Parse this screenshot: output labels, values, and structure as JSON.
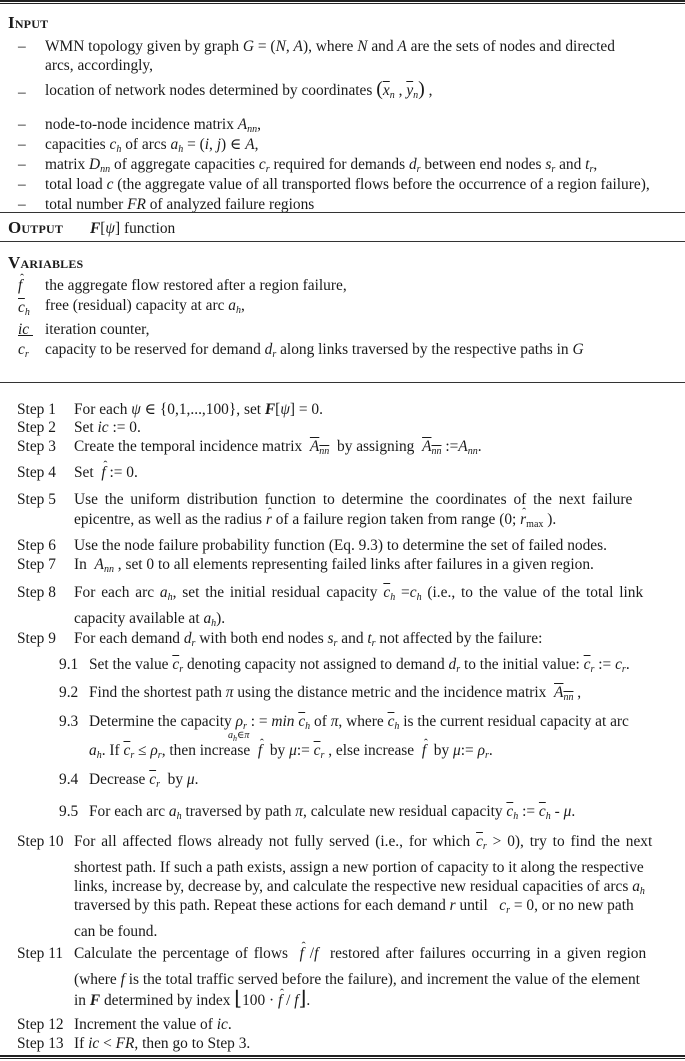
{
  "input": {
    "heading": "Input",
    "items": [
      {
        "parts": [
          "WMN topology given by graph ",
          "G",
          " = (",
          "N",
          ", ",
          "A",
          "), where ",
          "N",
          " and ",
          "A",
          " are the sets of nodes and directed"
        ],
        "line1": "WMN topology given by graph G = (N, A), where N and A are the sets of nodes and directed",
        "line2": "arcs, accordingly,"
      },
      {
        "line1": "location of network nodes determined by coordinates",
        "math": "(x̄n, ȳn),"
      },
      {
        "line1": "node-to-node incidence matrix",
        "sym": "Ann,"
      },
      {
        "line1": "capacities ch of arcs ah = (i, j) ∈ A,"
      },
      {
        "line1": "matrix Dnn of aggregate capacities cr required for demands dr between end nodes sr and tr,"
      },
      {
        "line1": "total load c (the aggregate value of all transported flows before the occurrence of a region failure),"
      },
      {
        "line1": "total number FR of analyzed failure regions"
      }
    ],
    "bullet": "–"
  },
  "output": {
    "heading": "Output",
    "text": "F[ψ] function"
  },
  "variables": {
    "heading": "Variables",
    "items": [
      {
        "symbol": "f̂",
        "text": "the aggregate flow restored after a region failure,"
      },
      {
        "symbol": "c̄h",
        "text": "free (residual) capacity at arc ah,"
      },
      {
        "symbol": "ic",
        "text": "iteration counter,"
      },
      {
        "symbol": "c̄r",
        "text": "capacity to be reserved for demand dr along links traversed by the respective paths in G"
      }
    ]
  },
  "steps": [
    {
      "label": "Step 1",
      "text": "For each ψ ∈ {0,1,...,100}, set F[ψ] = 0."
    },
    {
      "label": "Step 2",
      "text": "Set ic := 0."
    },
    {
      "label": "Step 3",
      "text": "Create the temporal incidence matrix Ānn by assigning Ānn :=Ann."
    },
    {
      "label": "Step 4",
      "text": "Set f̂ := 0."
    },
    {
      "label": "Step 5",
      "line1": "Use the uniform distribution function to determine the coordinates  of the next failure",
      "line2": "epicentre, as well as the radius r̂ of a failure region taken from range (0; r̂max)."
    },
    {
      "label": "Step 6",
      "text": "Use the node failure probability function (Eq. 9.3) to determine the set of failed nodes."
    },
    {
      "label": "Step 7",
      "text": "In Ānn , set 0 to all elements representing failed links after failures in a given region."
    },
    {
      "label": "Step 8",
      "line1": "For each arc ah, set the initial residual capacity c̄h =ch (i.e., to the value of the total link",
      "line2": "capacity available at ah)."
    },
    {
      "label": "Step 9",
      "text": "For each demand dr with both end nodes sr and tr not affected by the failure:",
      "substeps": [
        {
          "label": "9.1",
          "text": "Set the value c̄r denoting capacity not assigned to demand dr to the initial value: c̄r := cr."
        },
        {
          "label": "9.2",
          "text": "Find the shortest path π using the distance metric and the incidence matrix Ānn ,"
        },
        {
          "label": "9.3",
          "line1": "Determine the capacity ρr : = min(ah∈π) c̄h of π, where c̄h is the current residual capacity at arc",
          "line2": "ah. If c̄r ≤ ρr, then increase f̂ by μ:= c̄r , else increase f̂ by μ:= ρr."
        },
        {
          "label": "9.4",
          "text": "Decrease c̄r by μ."
        },
        {
          "label": "9.5",
          "text": "For each arc ah traversed by path π, calculate new residual capacity c̄h := c̄h - μ."
        }
      ]
    },
    {
      "label": "Step 10",
      "lines": [
        "For all affected flows already not fully served (i.e., for which c̄r > 0), try to find the next",
        "shortest path. If such a path exists, assign a new portion of capacity to it along the respective",
        "links, increase by, decrease by, and calculate the respective new residual capacities of arcs ah",
        "traversed by this path. Repeat these actions for each demand r until c̄r = 0, or no new path",
        "can be found."
      ]
    },
    {
      "label": "Step 11",
      "lines": [
        "Calculate the percentage of flows f̂/f restored after failures occurring in a given region",
        "(where f is the total traffic served before the failure), and increment the value of the element",
        "in F determined by index ⌊100 · f̂ / f⌋."
      ]
    },
    {
      "label": "Step 12",
      "text": "Increment the value of ic."
    },
    {
      "label": "Step 13",
      "text": "If ic < FR, then go to Step 3."
    }
  ]
}
